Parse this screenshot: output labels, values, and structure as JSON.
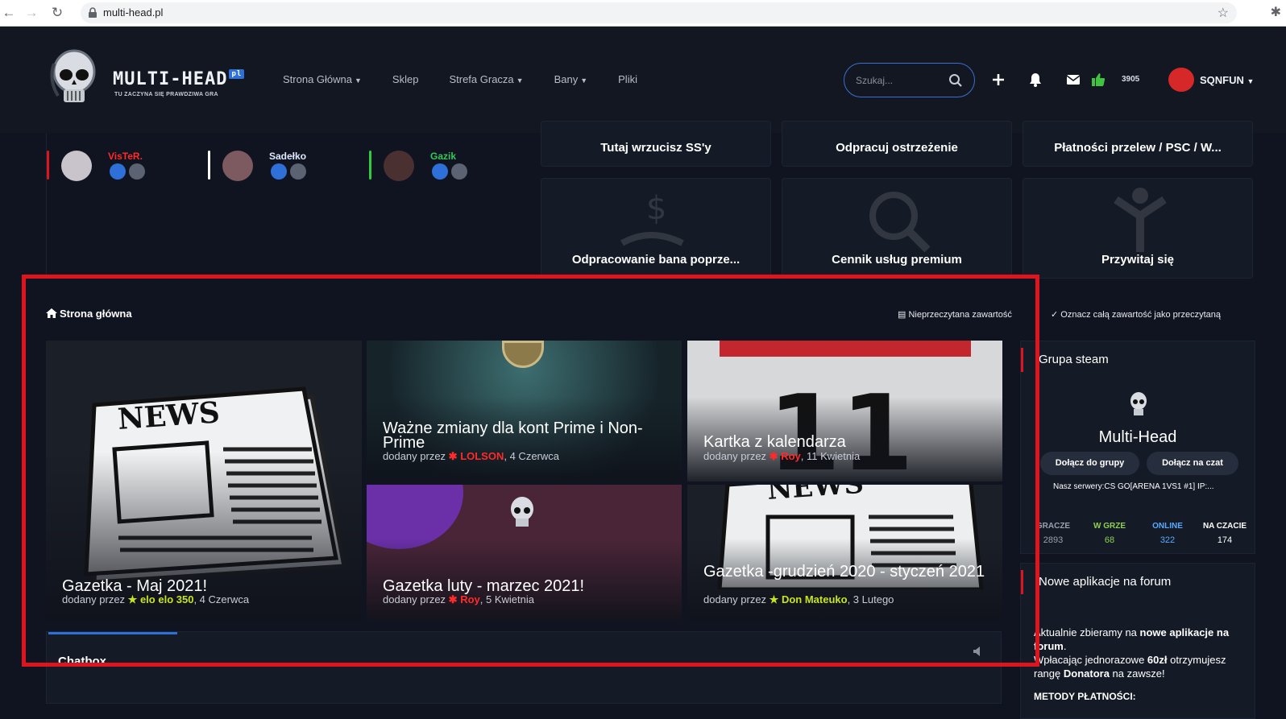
{
  "browser": {
    "url": "multi-head.pl"
  },
  "header": {
    "logo_text": "MULTI-HEAD",
    "logo_badge": "pl",
    "tagline": "TU ZACZYNA SIĘ PRAWDZIWA GRA",
    "nav": [
      {
        "label": "Strona Główna",
        "dropdown": true
      },
      {
        "label": "Sklep",
        "dropdown": false
      },
      {
        "label": "Strefa Gracza",
        "dropdown": true
      },
      {
        "label": "Bany",
        "dropdown": true
      },
      {
        "label": "Pliki",
        "dropdown": false
      }
    ],
    "search_placeholder": "Szukaj...",
    "reputation_count": "3905",
    "username": "SQNFUN"
  },
  "staff": [
    {
      "name": "VisTeR.",
      "color": "#ff2a2a",
      "bar": "#e0141e"
    },
    {
      "name": "Sadełko",
      "color": "#dfe9ff",
      "bar": "#ffffff"
    },
    {
      "name": "Gazik",
      "color": "#34c759",
      "bar": "#2ecc40"
    }
  ],
  "tiles": [
    {
      "title": "Tutaj wrzucisz SS'y"
    },
    {
      "title": "Odpracuj ostrzeżenie"
    },
    {
      "title": "Płatności przelew / PSC / W..."
    },
    {
      "title": "Odpracowanie bana poprze..."
    },
    {
      "title": "Cennik usług premium"
    },
    {
      "title": "Przywitaj się"
    }
  ],
  "breadcrumb": {
    "home": "Strona główna",
    "unread": "Nieprzeczytana zawartość",
    "mark_read": "Oznacz całą zawartość jako przeczytaną"
  },
  "articles": [
    {
      "title": "Gazetka - Maj 2021!",
      "meta_prefix": "dodany przez ",
      "author": "elo elo 350",
      "author_color": "#c6e51a",
      "date": ", 4 Czerwca"
    },
    {
      "title": "Ważne zmiany dla kont Prime i Non-Prime",
      "meta_prefix": "dodany przez ",
      "author": "LOLSON",
      "author_color": "#ff2a2a",
      "date": ", 4 Czerwca"
    },
    {
      "title": "Kartka z kalendarza",
      "meta_prefix": "dodany przez ",
      "author": "Roy",
      "author_color": "#ff2a2a",
      "date": ", 11 Kwietnia"
    },
    {
      "title": "Gazetka luty - marzec 2021!",
      "meta_prefix": "dodany przez ",
      "author": "Roy",
      "author_color": "#ff2a2a",
      "date": ", 5 Kwietnia"
    },
    {
      "title": "Gazetka -grudzień 2020 - styczeń 2021",
      "meta_prefix": "dodany przez ",
      "author": "Don Mateuko",
      "author_color": "#c6e51a",
      "date": ", 3 Lutego"
    }
  ],
  "chatbox": {
    "title": "Chatbox"
  },
  "steam_widget": {
    "title": "Grupa steam",
    "group_name": "Multi-Head",
    "join_group": "Dołącz do grupy",
    "join_chat": "Dołącz na czat",
    "description": "Nasz serwery:CS GO[ARENA 1VS1 #1] IP:...",
    "stats": [
      {
        "label": "GRACZE",
        "value": "2893",
        "color": "#9aa0ad"
      },
      {
        "label": "W GRZE",
        "value": "68",
        "color": "#8fd14f"
      },
      {
        "label": "ONLINE",
        "value": "322",
        "color": "#5aa9ff"
      },
      {
        "label": "NA CZACIE",
        "value": "174",
        "color": "#ffffff"
      }
    ]
  },
  "apps_widget": {
    "title": "Nowe aplikacje na forum",
    "line1_a": "Aktualnie zbieramy na ",
    "line1_b": "nowe aplikacje na forum",
    "line2_a": "Wpłacając jednorazowe ",
    "line2_b": "60zł",
    "line3_a": " otrzymujesz rangę ",
    "line3_b": "Donatora",
    "line3_c": " na zawsze!",
    "payments_label": "METODY PŁATNOŚCI:"
  }
}
